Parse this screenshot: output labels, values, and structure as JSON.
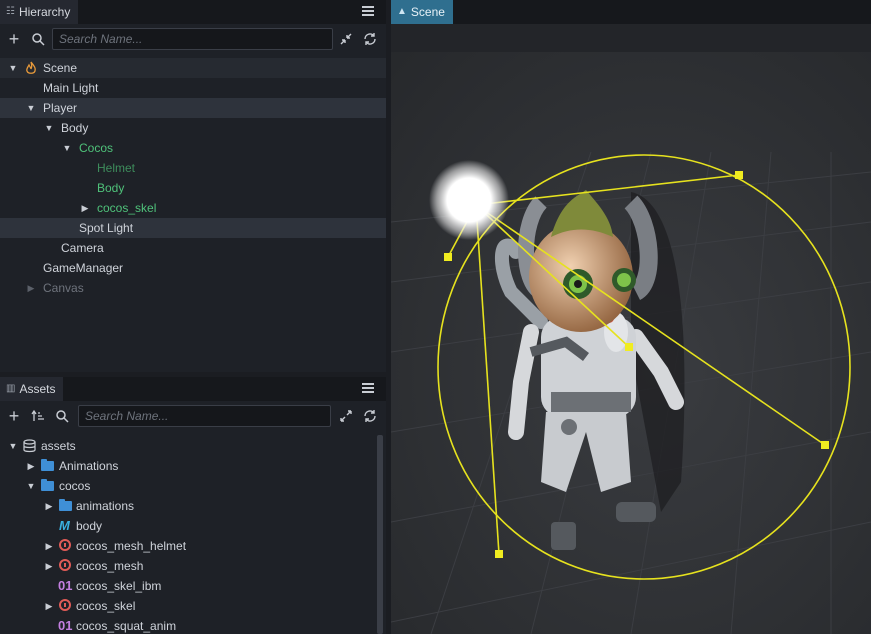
{
  "hierarchy": {
    "tab_label": "Hierarchy",
    "search_placeholder": "Search Name...",
    "nodes": [
      {
        "label": "Scene"
      },
      {
        "label": "Main Light"
      },
      {
        "label": "Player"
      },
      {
        "label": "Body"
      },
      {
        "label": "Cocos"
      },
      {
        "label": "Helmet"
      },
      {
        "label": "Body"
      },
      {
        "label": "cocos_skel"
      },
      {
        "label": "Spot Light"
      },
      {
        "label": "Camera"
      },
      {
        "label": "GameManager"
      },
      {
        "label": "Canvas"
      }
    ]
  },
  "assets": {
    "tab_label": "Assets",
    "search_placeholder": "Search Name...",
    "items": [
      {
        "label": "assets"
      },
      {
        "label": "Animations"
      },
      {
        "label": "cocos"
      },
      {
        "label": "animations"
      },
      {
        "label": "body"
      },
      {
        "label": "cocos_mesh_helmet"
      },
      {
        "label": "cocos_mesh"
      },
      {
        "label": "cocos_skel_ibm",
        "badge": "01"
      },
      {
        "label": "cocos_skel"
      },
      {
        "label": "cocos_squat_anim",
        "badge": "01"
      }
    ]
  },
  "scene": {
    "tab_label": "Scene"
  },
  "colors": {
    "accent_tab": "#2f6f8f",
    "gizmo": "#e6e21e",
    "selected_green": "#4fc27a"
  }
}
